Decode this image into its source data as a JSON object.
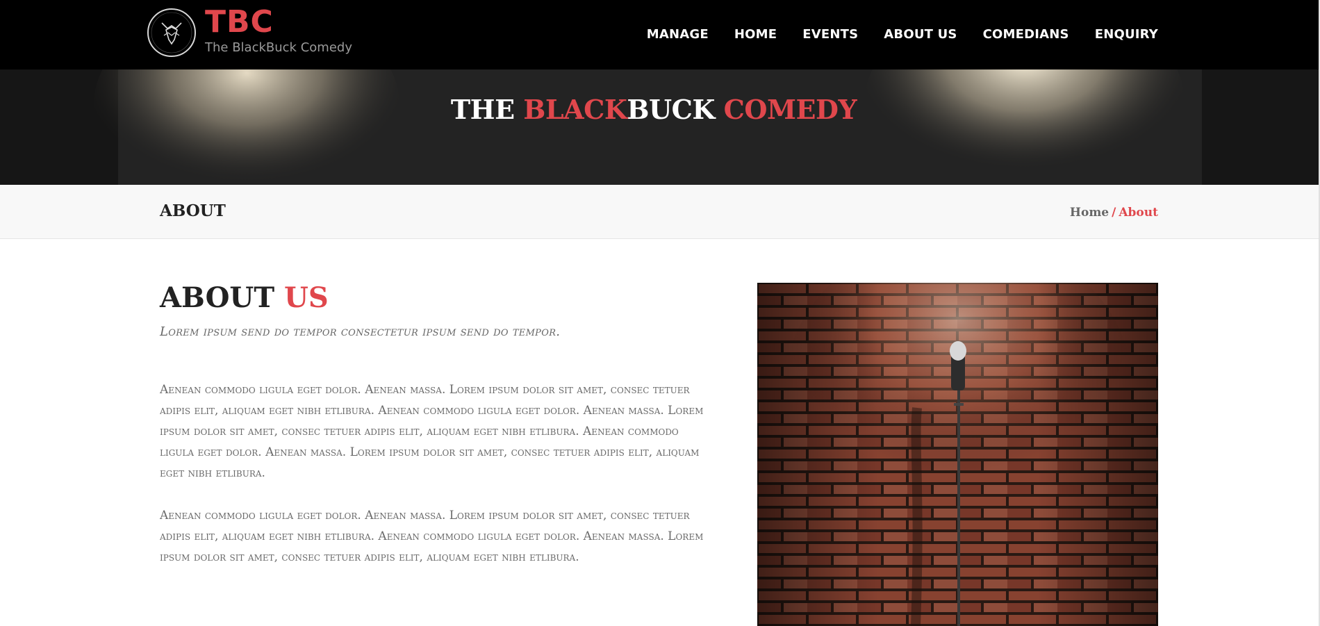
{
  "brand": {
    "title": "TBC",
    "subtitle": "The BlackBuck Comedy"
  },
  "nav": {
    "items": [
      "MANAGE",
      "HOME",
      "EVENTS",
      "ABOUT US",
      "COMEDIANS",
      "ENQUIRY"
    ]
  },
  "hero": {
    "word1": "THE",
    "word2": "BLACK",
    "word3": "BUCK",
    "word4": "COMEDY"
  },
  "breadcrumb": {
    "title": "ABOUT",
    "home": "Home",
    "separator": "/",
    "current": "About"
  },
  "about": {
    "heading_1": "ABOUT",
    "heading_2": "US",
    "subtitle": "Lorem ipsum send do tempor consectetur ipsum send do tempor.",
    "paragraph_1": "Aenean commodo ligula eget dolor. Aenean massa. Lorem ipsum dolor sit amet, consec tetuer adipis elit, aliquam eget nibh etlibura. Aenean commodo ligula eget dolor. Aenean massa. Lorem ipsum dolor sit amet, consec tetuer adipis elit, aliquam eget nibh etlibura. Aenean commodo ligula eget dolor. Aenean massa. Lorem ipsum dolor sit amet, consec tetuer adipis elit, aliquam eget nibh etlibura.",
    "paragraph_2": "Aenean commodo ligula eget dolor. Aenean massa. Lorem ipsum dolor sit amet, consec tetuer adipis elit, aliquam eget nibh etlibura. Aenean commodo ligula eget dolor. Aenean massa. Lorem ipsum dolor sit amet, consec tetuer adipis elit, aliquam eget nibh etlibura."
  },
  "colors": {
    "accent": "#e0474c",
    "navbar": "#000000",
    "text": "#6a6a6a"
  },
  "icons": {
    "logo": "blackbuck-logo-icon",
    "photo": "microphone-brick-wall-photo"
  }
}
